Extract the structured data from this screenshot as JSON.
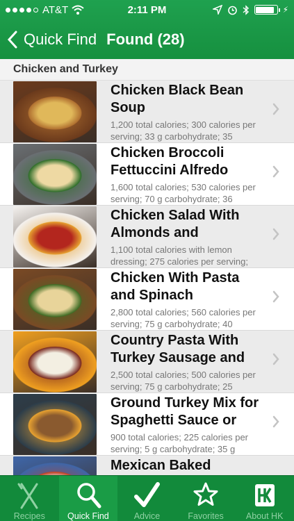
{
  "status_bar": {
    "carrier": "AT&T",
    "time": "2:11 PM",
    "signal_bars_filled": 4,
    "signal_bars_total": 5,
    "battery_level": 0.9
  },
  "nav": {
    "back_label": "Quick Find",
    "title": "Found (28)"
  },
  "section": {
    "title": "Chicken and Turkey"
  },
  "recipes": [
    {
      "title": "Chicken Black Bean Soup",
      "desc": "1,200 total calories; 300 calories per serving; 33 g carbohydrate; 35",
      "image": "soup-bowl-photo",
      "palette": [
        "#6b3a1c",
        "#e0b85a",
        "#b07030"
      ]
    },
    {
      "title": "Chicken Broccoli Fettuccini Alfredo",
      "desc": "1,600 total calories; 530 calories per serving; 70 g carbohydrate; 36",
      "image": "pasta-dish-photo",
      "palette": [
        "#6a6f73",
        "#eed9a3",
        "#2f6e2a"
      ]
    },
    {
      "title": "Chicken Salad With Almonds and",
      "desc": "1,100 total calories with lemon dressing; 275 calories per serving;",
      "image": "salad-plate-photo",
      "palette": [
        "#f4f1ee",
        "#b3261e",
        "#e6a030"
      ]
    },
    {
      "title": "Chicken With Pasta and Spinach",
      "desc": "2,800 total calories; 560 calories per serving; 75 g carbohydrate; 40",
      "image": "pasta-spinach-photo",
      "palette": [
        "#7a4a25",
        "#e8d49a",
        "#3f6b24"
      ]
    },
    {
      "title": "Country Pasta With Turkey Sausage and",
      "desc": "2,500 total calories; 500 calories per serving; 75 g carbohydrate; 25",
      "image": "pasta-beans-photo",
      "palette": [
        "#f0a020",
        "#f3efe2",
        "#7a2a20"
      ]
    },
    {
      "title": "Ground Turkey Mix for Spaghetti Sauce or",
      "desc": "900 total calories; 225 calories per serving; 5 g carbohydrate; 35 g",
      "image": "turkey-container-photo",
      "palette": [
        "#2c3d4a",
        "#8a5a2f",
        "#e8a230"
      ]
    },
    {
      "title": "Mexican Baked Chicken and Tortillas",
      "desc": "",
      "image": "baked-dish-photo",
      "palette": [
        "#3f66a8",
        "#e2e6ee",
        "#c24020"
      ]
    }
  ],
  "tabs": [
    {
      "label": "Recipes",
      "icon": "fork-knife-icon",
      "selected": false
    },
    {
      "label": "Quick Find",
      "icon": "magnifier-icon",
      "selected": true
    },
    {
      "label": "Advice",
      "icon": "checkmark-icon",
      "selected": false
    },
    {
      "label": "Favorites",
      "icon": "star-icon",
      "selected": false
    },
    {
      "label": "About HK",
      "icon": "hk-logo-icon",
      "selected": false
    }
  ],
  "colors": {
    "brand_green": "#16903f",
    "tab_bar_green": "#128a3b",
    "tab_selected_green": "#1a9c46"
  }
}
